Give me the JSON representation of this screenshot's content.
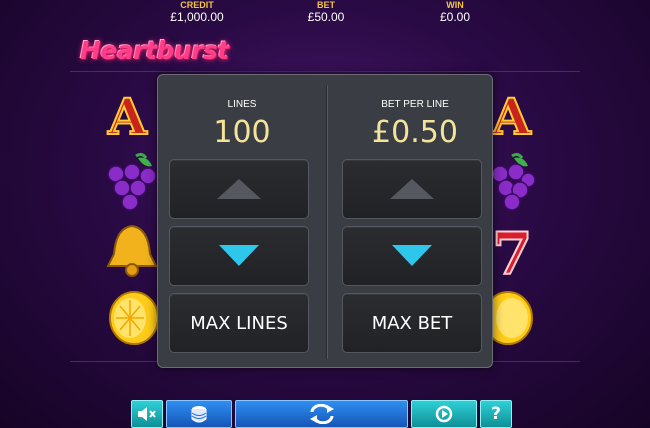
{
  "hud": {
    "credit_label": "CREDIT",
    "credit_value": "£1,000.00",
    "bet_label": "BET",
    "bet_value": "£50.00",
    "win_label": "WIN",
    "win_value": "£0.00"
  },
  "logo_text": "HEARTBURST",
  "settings_panel": {
    "lines_label": "LINES",
    "lines_value": "100",
    "bet_per_line_label": "BET PER LINE",
    "bet_per_line_value": "£0.50",
    "max_lines_label": "MAX LINES",
    "max_bet_label": "MAX BET"
  },
  "reel_symbols_left": [
    "A",
    "grapes",
    "bell",
    "lemon"
  ],
  "reel_symbols_right": [
    "A",
    "grapes",
    "7",
    "lemon"
  ],
  "colors": {
    "accent_yellow": "#f3e49a",
    "panel_bg": "#3a3d43",
    "arrow_active": "#2ec6ea",
    "arrow_inactive": "#55585e",
    "button_teal": "#1fb3ba",
    "button_blue": "#1f6fd6"
  },
  "bottom_controls": [
    "mute-icon",
    "coins-icon",
    "spin-icon",
    "autoplay-icon",
    "help-icon"
  ]
}
